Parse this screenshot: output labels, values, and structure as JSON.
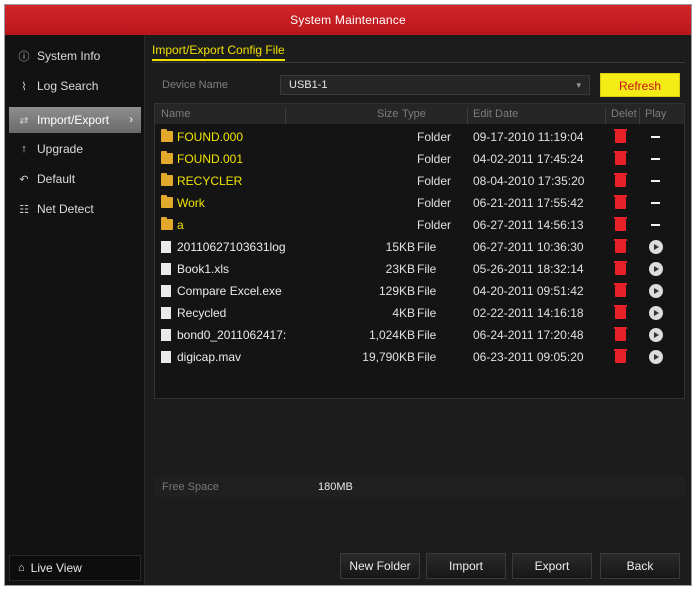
{
  "window": {
    "title": "System Maintenance"
  },
  "sidebar": {
    "items": [
      {
        "label": "System Info",
        "icon": "info-icon"
      },
      {
        "label": "Log Search",
        "icon": "search-log-icon"
      },
      {
        "label": "Import/Export",
        "icon": "import-export-icon",
        "active": true
      },
      {
        "label": "Upgrade",
        "icon": "upgrade-icon"
      },
      {
        "label": "Default",
        "icon": "default-icon"
      },
      {
        "label": "Net Detect",
        "icon": "net-detect-icon"
      }
    ],
    "live_view": "Live View"
  },
  "main": {
    "tab": "Import/Export Config File",
    "device_label": "Device Name",
    "device_value": "USB1-1",
    "refresh": "Refresh",
    "columns": {
      "name": "Name",
      "size": "Size",
      "type": "Type",
      "edit_date": "Edit Date",
      "delete": "Delet",
      "play": "Play"
    },
    "files": [
      {
        "name": "FOUND.000",
        "size": "",
        "type": "Folder",
        "date": "09-17-2010 11:19:04",
        "kind": "folder"
      },
      {
        "name": "FOUND.001",
        "size": "",
        "type": "Folder",
        "date": "04-02-2011 17:45:24",
        "kind": "folder"
      },
      {
        "name": "RECYCLER",
        "size": "",
        "type": "Folder",
        "date": "08-04-2010 17:35:20",
        "kind": "folder"
      },
      {
        "name": "Work",
        "size": "",
        "type": "Folder",
        "date": "06-21-2011 17:55:42",
        "kind": "folder"
      },
      {
        "name": "a",
        "size": "",
        "type": "Folder",
        "date": "06-27-2011 14:56:13",
        "kind": "folder"
      },
      {
        "name": "20110627103631log",
        "size": "15KB",
        "type": "File",
        "date": "06-27-2011 10:36:30",
        "kind": "file"
      },
      {
        "name": "Book1.xls",
        "size": "23KB",
        "type": "File",
        "date": "05-26-2011 18:32:14",
        "kind": "file"
      },
      {
        "name": "Compare Excel.exe",
        "size": "129KB",
        "type": "File",
        "date": "04-20-2011 09:51:42",
        "kind": "file"
      },
      {
        "name": "Recycled",
        "size": "4KB",
        "type": "File",
        "date": "02-22-2011 14:16:18",
        "kind": "file"
      },
      {
        "name": "bond0_2011062417:",
        "size": "1,024KB",
        "type": "File",
        "date": "06-24-2011 17:20:48",
        "kind": "file"
      },
      {
        "name": "digicap.mav",
        "size": "19,790KB",
        "type": "File",
        "date": "06-23-2011 09:05:20",
        "kind": "file"
      }
    ],
    "free_space_label": "Free Space",
    "free_space_value": "180MB",
    "buttons": {
      "new_folder": "New Folder",
      "import": "Import",
      "export": "Export",
      "back": "Back"
    }
  },
  "colors": {
    "title_red": "#c51d22",
    "folder_yellow": "#f2e300",
    "refresh_yellow": "#f4ec16",
    "delete_red": "#e6212a"
  }
}
